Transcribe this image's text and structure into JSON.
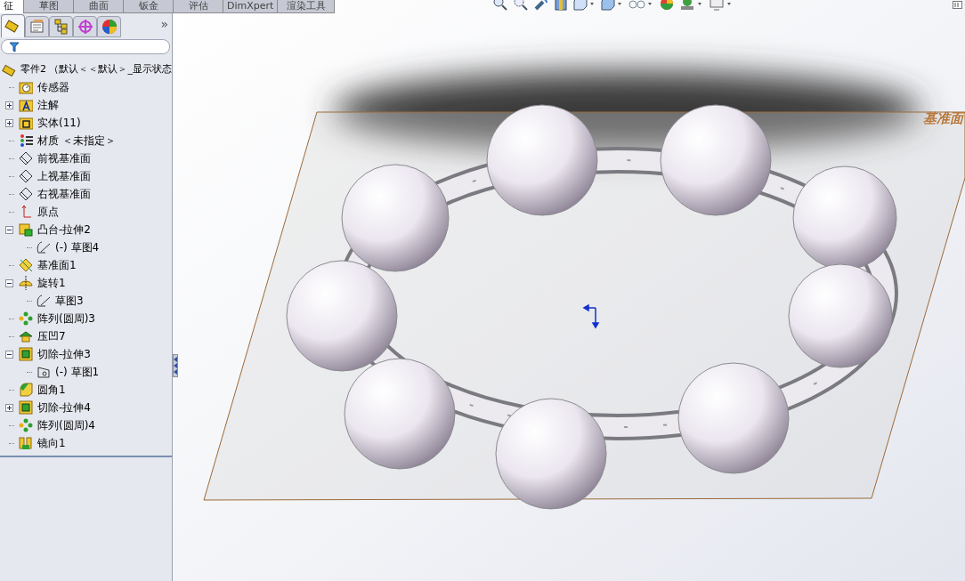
{
  "command_tabs": [
    {
      "label": "征",
      "selected": true
    },
    {
      "label": "草图",
      "selected": false
    },
    {
      "label": "曲面",
      "selected": false
    },
    {
      "label": "钣金",
      "selected": false
    },
    {
      "label": "评估",
      "selected": false
    },
    {
      "label": "DimXpert",
      "selected": false
    },
    {
      "label": "渲染工具",
      "selected": false
    }
  ],
  "panel_tabs": [
    {
      "kind": "tree",
      "selected": true
    },
    {
      "kind": "property",
      "selected": false
    },
    {
      "kind": "config",
      "selected": false
    },
    {
      "kind": "dim",
      "selected": false
    },
    {
      "kind": "display",
      "selected": false
    }
  ],
  "panel_more": "»",
  "feature_tree": {
    "root": "零件2 （默认＜＜默认＞_显示状态",
    "items": [
      {
        "label": "传感器",
        "kind": "sensor"
      },
      {
        "label": "注解",
        "kind": "annotation",
        "expanded": false
      },
      {
        "label": "实体(11)",
        "kind": "body",
        "expanded": false
      },
      {
        "label": "材质 ＜未指定＞",
        "kind": "material"
      },
      {
        "label": "前视基准面",
        "kind": "plane"
      },
      {
        "label": "上视基准面",
        "kind": "plane"
      },
      {
        "label": "右视基准面",
        "kind": "plane"
      },
      {
        "label": "原点",
        "kind": "origin"
      },
      {
        "label": "凸台-拉伸2",
        "kind": "boss",
        "expanded": true,
        "children": [
          {
            "label": "(-) 草图4",
            "kind": "sketch"
          }
        ]
      },
      {
        "label": "基准面1",
        "kind": "refplane"
      },
      {
        "label": "旋转1",
        "kind": "revolve",
        "expanded": true,
        "children": [
          {
            "label": "草图3",
            "kind": "sketch"
          }
        ]
      },
      {
        "label": "阵列(圆周)3",
        "kind": "pattern"
      },
      {
        "label": "压凹7",
        "kind": "indent"
      },
      {
        "label": "切除-拉伸3",
        "kind": "cut",
        "expanded": true,
        "children": [
          {
            "label": "(-) 草图1",
            "kind": "sketchcut"
          }
        ]
      },
      {
        "label": "圆角1",
        "kind": "fillet"
      },
      {
        "label": "切除-拉伸4",
        "kind": "cut",
        "expanded": false
      },
      {
        "label": "阵列(圆周)4",
        "kind": "pattern"
      },
      {
        "label": "镜向1",
        "kind": "mirror"
      }
    ]
  },
  "viewport": {
    "plane_label": "基准面"
  }
}
